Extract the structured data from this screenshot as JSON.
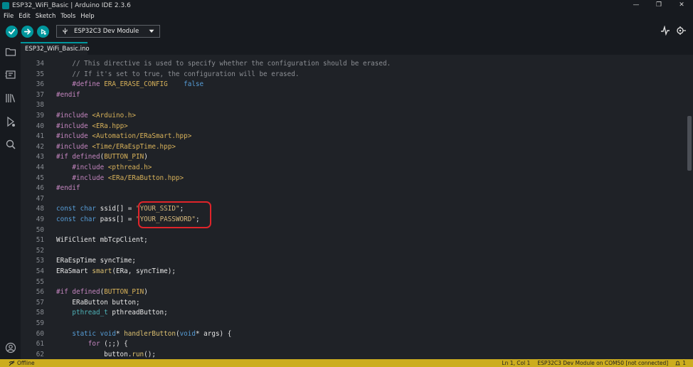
{
  "window": {
    "title": "ESP32_WiFi_Basic | Arduino IDE 2.3.6",
    "controls": [
      "—",
      "❐",
      "✕"
    ]
  },
  "menu": [
    "File",
    "Edit",
    "Sketch",
    "Tools",
    "Help"
  ],
  "toolbar": {
    "board": "ESP32C3 Dev Module"
  },
  "tab": {
    "name": "ESP32_WiFi_Basic.ino"
  },
  "editor": {
    "lines": [
      {
        "n": "34",
        "parts": [
          [
            "    ",
            ""
          ],
          [
            "// This directive is used to specify whether the configuration should be erased.",
            "c"
          ]
        ]
      },
      {
        "n": "35",
        "parts": [
          [
            "    ",
            ""
          ],
          [
            "// If it's set to true, the configuration will be erased.",
            "c"
          ]
        ]
      },
      {
        "n": "36",
        "parts": [
          [
            "    ",
            ""
          ],
          [
            "#define",
            "k"
          ],
          [
            " ",
            ""
          ],
          [
            "ERA_ERASE_CONFIG",
            "i"
          ],
          [
            "    ",
            ""
          ],
          [
            "false",
            "t"
          ]
        ]
      },
      {
        "n": "37",
        "parts": [
          [
            "#endif",
            "k"
          ]
        ]
      },
      {
        "n": "38",
        "parts": []
      },
      {
        "n": "39",
        "parts": [
          [
            "#include",
            "k"
          ],
          [
            " ",
            ""
          ],
          [
            "<Arduino.h>",
            "i"
          ]
        ]
      },
      {
        "n": "40",
        "parts": [
          [
            "#include",
            "k"
          ],
          [
            " ",
            ""
          ],
          [
            "<ERa.hpp>",
            "i"
          ]
        ]
      },
      {
        "n": "41",
        "parts": [
          [
            "#include",
            "k"
          ],
          [
            " ",
            ""
          ],
          [
            "<Automation/ERaSmart.hpp>",
            "i"
          ]
        ]
      },
      {
        "n": "42",
        "parts": [
          [
            "#include",
            "k"
          ],
          [
            " ",
            ""
          ],
          [
            "<Time/ERaEspTime.hpp>",
            "i"
          ]
        ]
      },
      {
        "n": "43",
        "parts": [
          [
            "#if",
            "k"
          ],
          [
            " ",
            ""
          ],
          [
            "defined",
            "k"
          ],
          [
            "(",
            ""
          ],
          [
            "BUTTON_PIN",
            "i"
          ],
          [
            ")",
            ""
          ]
        ]
      },
      {
        "n": "44",
        "parts": [
          [
            "    ",
            ""
          ],
          [
            "#include",
            "k"
          ],
          [
            " ",
            ""
          ],
          [
            "<pthread.h>",
            "i"
          ]
        ]
      },
      {
        "n": "45",
        "parts": [
          [
            "    ",
            ""
          ],
          [
            "#include",
            "k"
          ],
          [
            " ",
            ""
          ],
          [
            "<ERa/ERaButton.hpp>",
            "i"
          ]
        ]
      },
      {
        "n": "46",
        "parts": [
          [
            "#endif",
            "k"
          ]
        ]
      },
      {
        "n": "47",
        "parts": []
      },
      {
        "n": "48",
        "parts": [
          [
            "const",
            "t"
          ],
          [
            " ",
            ""
          ],
          [
            "char",
            "t"
          ],
          [
            " ssid[] = ",
            ""
          ],
          [
            "\"YOUR_SSID\"",
            "s"
          ],
          [
            ";",
            ""
          ]
        ]
      },
      {
        "n": "49",
        "parts": [
          [
            "const",
            "t"
          ],
          [
            " ",
            ""
          ],
          [
            "char",
            "t"
          ],
          [
            " pass[] = ",
            ""
          ],
          [
            "\"YOUR_PASSWORD\"",
            "s"
          ],
          [
            ";",
            ""
          ]
        ]
      },
      {
        "n": "50",
        "parts": []
      },
      {
        "n": "51",
        "parts": [
          [
            "WiFiClient mbTcpClient;",
            ""
          ]
        ]
      },
      {
        "n": "52",
        "parts": []
      },
      {
        "n": "53",
        "parts": [
          [
            "ERaEspTime syncTime;",
            ""
          ]
        ]
      },
      {
        "n": "54",
        "parts": [
          [
            "ERaSmart ",
            ""
          ],
          [
            "smart",
            "fn"
          ],
          [
            "(ERa, syncTime);",
            ""
          ]
        ]
      },
      {
        "n": "55",
        "parts": []
      },
      {
        "n": "56",
        "parts": [
          [
            "#if",
            "k"
          ],
          [
            " ",
            ""
          ],
          [
            "defined",
            "k"
          ],
          [
            "(",
            ""
          ],
          [
            "BUTTON_PIN",
            "i"
          ],
          [
            ")",
            ""
          ]
        ]
      },
      {
        "n": "57",
        "parts": [
          [
            "    ERaButton button;",
            ""
          ]
        ]
      },
      {
        "n": "58",
        "parts": [
          [
            "    ",
            ""
          ],
          [
            "pthread_t",
            "lit"
          ],
          [
            " pthreadButton;",
            ""
          ]
        ]
      },
      {
        "n": "59",
        "parts": []
      },
      {
        "n": "60",
        "parts": [
          [
            "    ",
            ""
          ],
          [
            "static",
            "t"
          ],
          [
            " ",
            ""
          ],
          [
            "void",
            "t"
          ],
          [
            "* ",
            ""
          ],
          [
            "handlerButton",
            "fn"
          ],
          [
            "(",
            ""
          ],
          [
            "void",
            "t"
          ],
          [
            "* args) {",
            ""
          ]
        ]
      },
      {
        "n": "61",
        "parts": [
          [
            "        ",
            ""
          ],
          [
            "for",
            "k"
          ],
          [
            " (;;) {",
            ""
          ]
        ]
      },
      {
        "n": "62",
        "parts": [
          [
            "            button.",
            ""
          ],
          [
            "run",
            "fn"
          ],
          [
            "();",
            ""
          ]
        ]
      }
    ]
  },
  "status": {
    "connection": "Offline",
    "position": "Ln 1, Col 1",
    "board": "ESP32C3 Dev Module on COM50 [not connected]",
    "notifications": "1"
  }
}
